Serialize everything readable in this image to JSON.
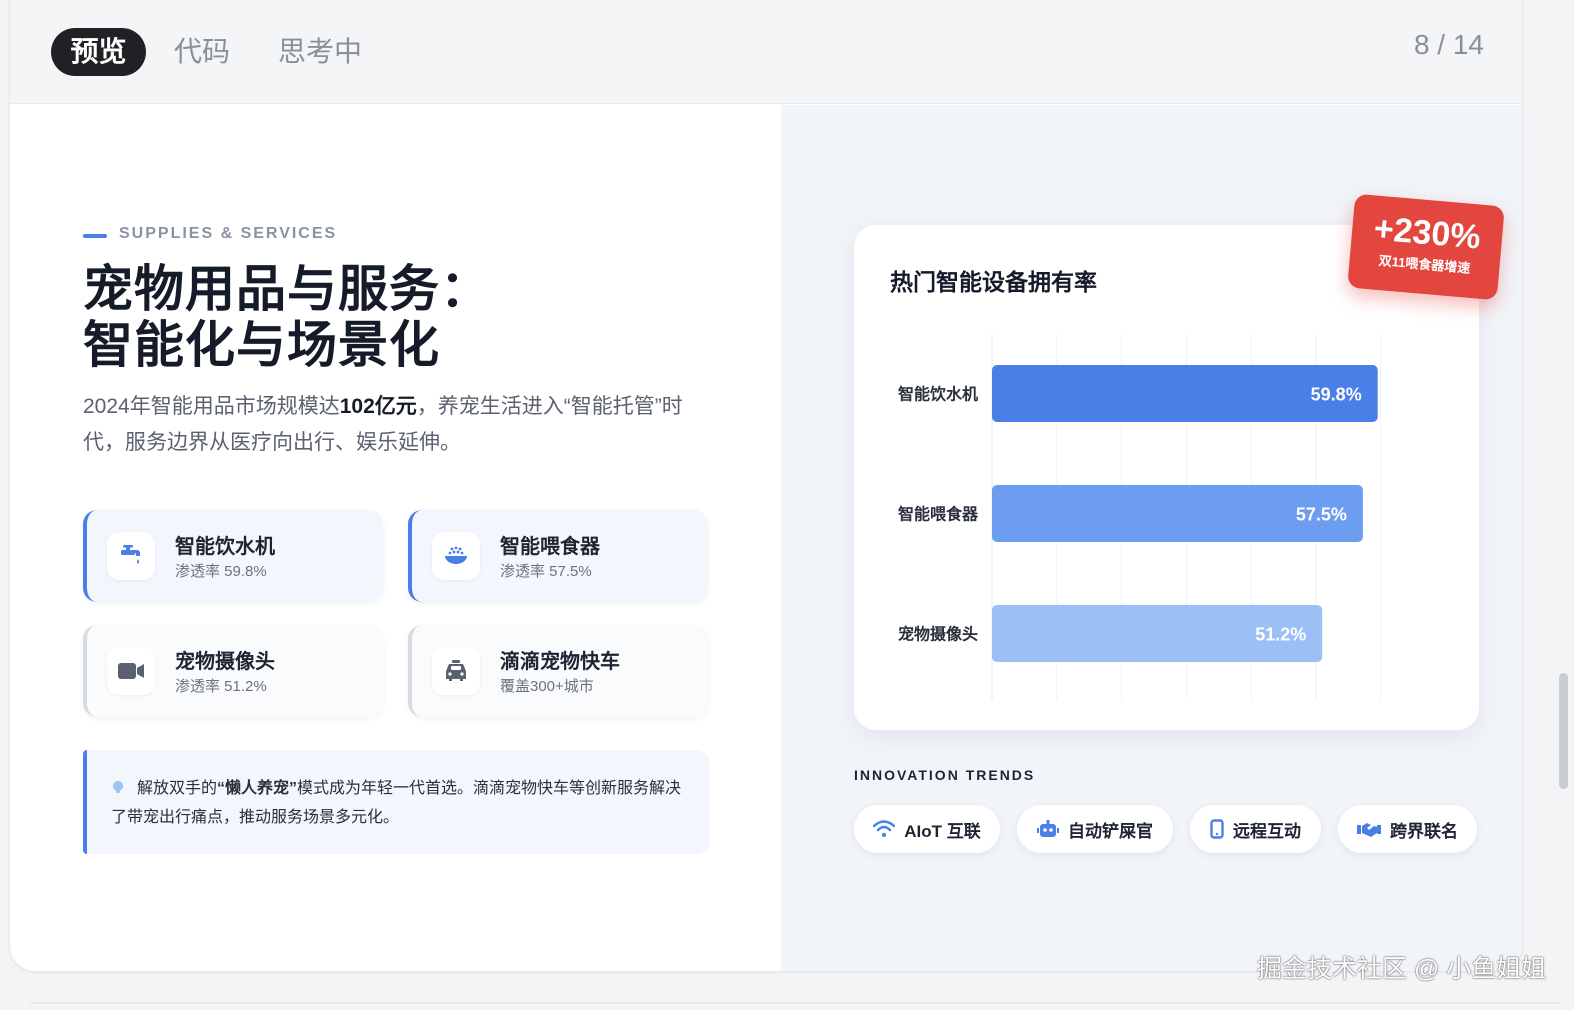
{
  "tabs": [
    {
      "label": "预览",
      "active": true
    },
    {
      "label": "代码",
      "active": false
    },
    {
      "label": "思考中",
      "active": false
    }
  ],
  "pager": "8 / 14",
  "hero": {
    "kicker": "SUPPLIES & SERVICES",
    "title_line1": "宠物用品与服务：",
    "title_line2": "智能化与场景化",
    "desc_pre": "2024年智能用品市场规模达",
    "desc_bold": "102亿元",
    "desc_post": "，养宠生活进入“智能托管”时代，服务边界从医疗向出行、娱乐延伸。"
  },
  "cards": [
    {
      "title": "智能饮水机",
      "sub": "渗透率 59.8%",
      "icon": "faucet-icon"
    },
    {
      "title": "智能喂食器",
      "sub": "渗透率 57.5%",
      "icon": "food-bowl-icon"
    },
    {
      "title": "宠物摄像头",
      "sub": "渗透率 51.2%",
      "icon": "video-camera-icon"
    },
    {
      "title": "滴滴宠物快车",
      "sub": "覆盖300+城市",
      "icon": "car-icon"
    }
  ],
  "note": {
    "pre": "解放双手的",
    "bold": "“懒人养宠”",
    "post": "模式成为年轻一代首选。滴滴宠物快车等创新服务解决了带宠出行痛点，推动服务场景多元化。"
  },
  "stamp": {
    "big": "+230%",
    "small": "双11喂食器增速"
  },
  "chart_data": {
    "type": "bar",
    "orientation": "horizontal",
    "title": "热门智能设备拥有率",
    "categories": [
      "智能饮水机",
      "智能喂食器",
      "宠物摄像头"
    ],
    "values": [
      59.8,
      57.5,
      51.2
    ],
    "value_labels": [
      "59.8%",
      "57.5%",
      "51.2%"
    ],
    "colors": [
      "#4a7fe8",
      "#6c9df0",
      "#9cbff6"
    ],
    "xlim": [
      0,
      100
    ],
    "grid": true
  },
  "trends": {
    "label": "INNOVATION TRENDS",
    "chips": [
      {
        "label": "AIoT 互联",
        "icon": "wifi-icon"
      },
      {
        "label": "自动铲屎官",
        "icon": "robot-icon"
      },
      {
        "label": "远程互动",
        "icon": "mobile-icon"
      },
      {
        "label": "跨界联名",
        "icon": "handshake-icon"
      }
    ]
  },
  "watermark": "掘金技术社区 @ 小鱼姐姐",
  "colors": {
    "accent": "#4a7fe8",
    "stamp": "#e2463f",
    "dark": "#1f2125"
  }
}
